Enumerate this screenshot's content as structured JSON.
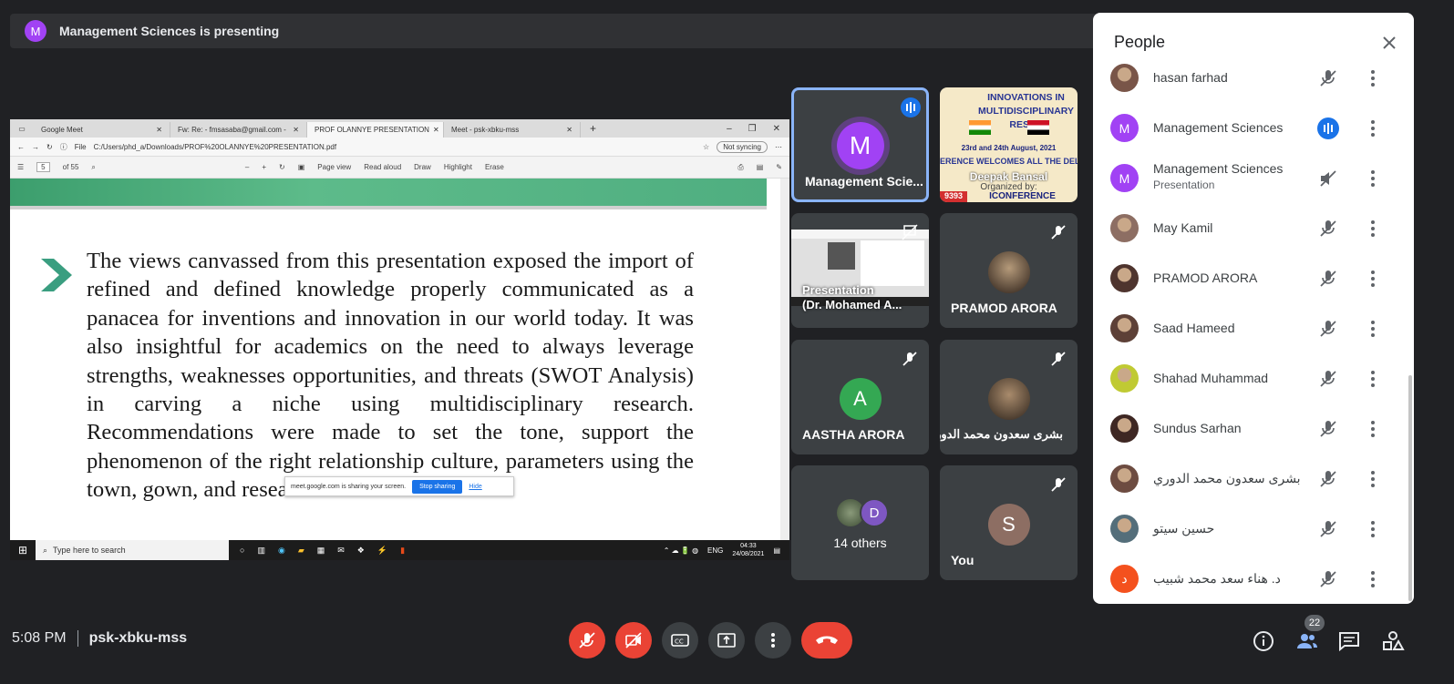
{
  "banner": {
    "avatar_letter": "M",
    "text": "Management Sciences is presenting"
  },
  "screen": {
    "tabs": [
      {
        "label": "Google Meet"
      },
      {
        "label": "Fw: Re: - fmsasaba@gmail.com -"
      },
      {
        "label": "PROF OLANNYE PRESENTATION"
      },
      {
        "label": "Meet - psk-xbku-mss"
      }
    ],
    "address": {
      "file_label": "File",
      "url": "C:/Users/phd_a/Downloads/PROF%20OLANNYE%20PRESENTATION.pdf",
      "sync": "Not syncing"
    },
    "pdf_toolbar": {
      "page": "5",
      "of_pages": "of 55",
      "page_view": "Page view",
      "read_aloud": "Read aloud",
      "draw": "Draw",
      "highlight": "Highlight",
      "erase": "Erase"
    },
    "body_text": "The views canvassed from this presentation exposed the import of refined and defined knowledge properly communicated as a panacea for inventions and innovation in our world today. It was also insightful for academics on the need to always leverage strengths, weaknesses opportunities, and threats (SWOT Analysis) in carving a niche using multidisciplinary research. Recommendations were made to set the tone, support the phenomenon of the right relationship culture, parameters using the town, gown, and research",
    "share_popup": {
      "text": "meet.google.com is sharing your screen.",
      "stop": "Stop sharing",
      "hide": "Hide"
    },
    "taskbar": {
      "search": "Type here to search",
      "lang": "ENG",
      "time": "04:33",
      "date": "24/08/2021"
    }
  },
  "tiles": {
    "t1": {
      "letter": "M",
      "name": "Management Scie...",
      "color": "#a142f4"
    },
    "t2": {
      "poster_title": "INNOVATIONS IN MULTIDISCIPLINARY RESEA",
      "poster_dates": "23rd and 24th August, 2021",
      "poster_line": "ERENCE WELCOMES ALL THE DELE",
      "poster_org": "Organized by:",
      "poster_brand": "ICONFERENCE",
      "poster_code": "9393",
      "name": "Deepak Bansal"
    },
    "t3": {
      "name_line1": "Presentation",
      "name_line2": "(Dr. Mohamed A..."
    },
    "t4": {
      "name": "PRAMOD ARORA"
    },
    "t5": {
      "letter": "A",
      "name": "AASTHA ARORA",
      "color": "#34a853"
    },
    "t6": {
      "name": "بشرى سعدون محمد الدوري"
    },
    "t7": {
      "letter": "D",
      "name": "14 others",
      "color": "#7e57c2"
    },
    "t8": {
      "letter": "S",
      "name": "You",
      "color": "#8d6e63"
    }
  },
  "people": {
    "title": "People",
    "rows": [
      {
        "name": "hasan farhad",
        "sub": "",
        "letter": "",
        "color": "#795548"
      },
      {
        "name": "Management Sciences",
        "sub": "",
        "letter": "M",
        "color": "#a142f4"
      },
      {
        "name": "Management Sciences",
        "sub": "Presentation",
        "letter": "M",
        "color": "#a142f4"
      },
      {
        "name": "May Kamil",
        "sub": "",
        "letter": "",
        "color": "#8d6e63"
      },
      {
        "name": "PRAMOD ARORA",
        "sub": "",
        "letter": "",
        "color": "#4e342e"
      },
      {
        "name": "Saad Hameed",
        "sub": "",
        "letter": "",
        "color": "#5d4037"
      },
      {
        "name": "Shahad Muhammad",
        "sub": "",
        "letter": "",
        "color": "#c0ca33"
      },
      {
        "name": "Sundus Sarhan",
        "sub": "",
        "letter": "",
        "color": "#3e2723"
      },
      {
        "name": "بشرى سعدون محمد الدوري",
        "sub": "",
        "letter": "",
        "color": "#6d4c41"
      },
      {
        "name": "حسين سيتو",
        "sub": "",
        "letter": "",
        "color": "#546e7a"
      },
      {
        "name": "د. هناء سعد محمد شبيب",
        "sub": "",
        "letter": "د",
        "color": "#f4511e"
      }
    ]
  },
  "bottom": {
    "time": "5:08 PM",
    "code": "psk-xbku-mss",
    "people_count": "22"
  }
}
